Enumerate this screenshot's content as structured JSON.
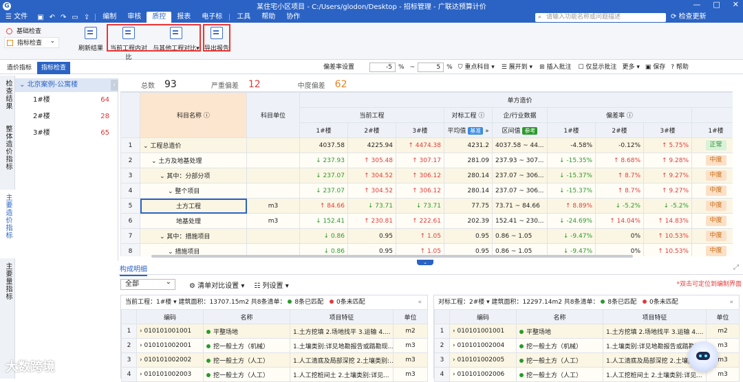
{
  "window": {
    "title": "某住宅小区项目 - C:/Users/glodon/Desktop - 招标管理 - 广联达预算计价",
    "controls": [
      "—",
      "□",
      "✕"
    ]
  },
  "menu": {
    "file": "文件",
    "items": [
      "编制",
      "审核",
      "质控",
      "报表",
      "电子标",
      "工具",
      "帮助",
      "协作"
    ],
    "active": "质控",
    "search_placeholder": "请输入功能名称或问题描述",
    "check_update": "检查更新"
  },
  "ribbon": {
    "leftnav": [
      "基础检查",
      "指标检查"
    ],
    "buttons": [
      "刷新结果",
      "当前工程内对比",
      "与其他工程对比",
      "导出报告"
    ]
  },
  "tabs": [
    "造价指标",
    "指标检查"
  ],
  "toolbar": {
    "deviation_label": "偏差率设置",
    "dev_low": "-5",
    "dev_high": "5",
    "pct": "%",
    "tilde": "~",
    "items": [
      "重点科目",
      "展开到",
      "插入批注",
      "仅显示批注",
      "更多",
      "保存",
      "帮助"
    ]
  },
  "side_tabs": [
    "检查结果",
    "整体造价指标",
    "主要造价指标",
    "主要量指标"
  ],
  "tree": {
    "root": "北京案例-公寓楼",
    "nodes": [
      {
        "label": "1#楼",
        "count": "64"
      },
      {
        "label": "2#楼",
        "count": "28"
      },
      {
        "label": "3#楼",
        "count": "65"
      }
    ]
  },
  "summary": {
    "total_label": "总数",
    "total": "93",
    "severe_label": "严重偏差",
    "severe": "12",
    "moderate_label": "中度偏差",
    "moderate": "62"
  },
  "grid": {
    "h_name": "科目名称",
    "h_unit": "科目单位",
    "h_unit_price": "单方造价",
    "h_current": "当前工程",
    "h_target": "对标工程",
    "h_industry": "企/行业数据",
    "h_deviation": "偏差率",
    "h_b1": "1#楼",
    "h_b2": "2#楼",
    "h_b3": "3#楼",
    "h_avg": "平均值",
    "h_avg_tag": "基准",
    "h_range": "区间值",
    "h_range_tag": "参考",
    "rows": [
      {
        "n": "1",
        "name": "工程总造价",
        "unit": "",
        "c1": "4037.58",
        "c2": "4225.94",
        "c3": "4474.38",
        "t": "4231.2",
        "r": "4037.58 ~ 44...",
        "d1": "-4.58%",
        "d2": "-0.12%",
        "d3": "5.75%",
        "s": "正常",
        "a": [
          "",
          "",
          "up"
        ],
        "da": [
          "",
          "",
          "up"
        ],
        "indent": 0
      },
      {
        "n": "2",
        "name": "土方及地基处理",
        "unit": "",
        "c1": "237.93",
        "c2": "305.48",
        "c3": "307.17",
        "t": "281.09",
        "r": "237.93 ~ 307...",
        "d1": "-15.35%",
        "d2": "8.68%",
        "d3": "9.28%",
        "s": "中度",
        "a": [
          "down",
          "up",
          "up"
        ],
        "da": [
          "down",
          "up",
          "up"
        ],
        "indent": 1
      },
      {
        "n": "3",
        "name": "其中：分部分项",
        "unit": "",
        "c1": "237.07",
        "c2": "304.52",
        "c3": "306.12",
        "t": "280.14",
        "r": "237.07 ~ 306...",
        "d1": "-15.37%",
        "d2": "8.7%",
        "d3": "9.27%",
        "s": "中度",
        "a": [
          "down",
          "up",
          "up"
        ],
        "da": [
          "down",
          "up",
          "up"
        ],
        "indent": 2
      },
      {
        "n": "4",
        "name": "整个项目",
        "unit": "",
        "c1": "237.07",
        "c2": "304.52",
        "c3": "306.12",
        "t": "280.14",
        "r": "237.07 ~ 306...",
        "d1": "-15.37%",
        "d2": "8.7%",
        "d3": "9.27%",
        "s": "中度",
        "a": [
          "down",
          "up",
          "up"
        ],
        "da": [
          "down",
          "up",
          "up"
        ],
        "indent": 3
      },
      {
        "n": "5",
        "name": "土方工程",
        "unit": "m3",
        "c1": "84.66",
        "c2": "73.71",
        "c3": "73.71",
        "t": "77.75",
        "r": "73.71 ~ 84.66",
        "d1": "8.89%",
        "d2": "-5.2%",
        "d3": "-5.2%",
        "s": "中度",
        "a": [
          "up",
          "down",
          "down"
        ],
        "da": [
          "up",
          "down",
          "down"
        ],
        "indent": 4
      },
      {
        "n": "6",
        "name": "地基处理",
        "unit": "m3",
        "c1": "152.41",
        "c2": "230.81",
        "c3": "222.61",
        "t": "202.39",
        "r": "152.41 ~ 230...",
        "d1": "-24.69%",
        "d2": "14.04%",
        "d3": "14.83%",
        "s": "中度",
        "a": [
          "down",
          "up",
          "up"
        ],
        "da": [
          "down",
          "up",
          "up"
        ],
        "indent": 4
      },
      {
        "n": "7",
        "name": "其中：措施项目",
        "unit": "",
        "c1": "0.86",
        "c2": "0.95",
        "c3": "1.05",
        "t": "0.95",
        "r": "0.86 ~ 1.05",
        "d1": "-9.47%",
        "d2": "0%",
        "d3": "10.53%",
        "s": "中度",
        "a": [
          "down",
          "",
          "up"
        ],
        "da": [
          "down",
          "",
          "up"
        ],
        "indent": 2
      },
      {
        "n": "8",
        "name": "措施项目",
        "unit": "",
        "c1": "0.86",
        "c2": "0.95",
        "c3": "1.05",
        "t": "0.95",
        "r": "0.86 ~ 1.05",
        "d1": "-9.47%",
        "d2": "0%",
        "d3": "10.53%",
        "s": "中度",
        "a": [
          "down",
          "",
          "up"
        ],
        "da": [
          "down",
          "",
          "up"
        ],
        "indent": 3
      }
    ]
  },
  "bottom": {
    "tab": "构成明细",
    "filter": "全部",
    "compare_setting": "清单对比设置",
    "col_setting": "列设置",
    "hint": "*双击可定位到编制界面",
    "left_pane": {
      "header": "当前工程：1#楼 ▾   建筑面积：13707.15m2   共8条清单：",
      "matched": "8条已匹配",
      "unmatched": "0条未匹配",
      "cols": [
        "编码",
        "名称",
        "项目特征",
        "单位"
      ],
      "rows": [
        {
          "n": "1",
          "code": "010101001001",
          "name": "平整场地",
          "feat": "1.土方挖填 2.场地找平 3.运输 4....",
          "unit": "m2"
        },
        {
          "n": "2",
          "code": "010101002001",
          "name": "挖一般土方（机械）",
          "feat": "1.土壤类别:详见地勘报告或踏勘现...",
          "unit": "m3"
        },
        {
          "n": "3",
          "code": "010101002002",
          "name": "挖一般土方（人工）",
          "feat": "1.人工清底及局部深挖 2.土壤类别:...",
          "unit": "m3"
        },
        {
          "n": "4",
          "code": "010101002003",
          "name": "挖一般土方（人工）",
          "feat": "1.人工挖桩间土 2.土壤类别:详见...",
          "unit": "m3"
        }
      ]
    },
    "right_pane": {
      "header": "对标工程：2#楼 ▾   建筑面积：12297.14m2   共8条清单：",
      "matched": "8条已匹配",
      "unmatched": "0条未匹配",
      "cols": [
        "编码",
        "名称",
        "项目特征",
        "单位"
      ],
      "rows": [
        {
          "n": "1",
          "code": "010101001001",
          "name": "平整场地",
          "feat": "1.土方挖填 2.场地找平 3.运输 4....",
          "unit": "m2"
        },
        {
          "n": "2",
          "code": "010101002004",
          "name": "挖一般土方（机械）",
          "feat": "1.土壤类别:详见地勘报告或踏勘现...",
          "unit": "m3"
        },
        {
          "n": "3",
          "code": "010101002005",
          "name": "挖一般土方（人工）",
          "feat": "1.人工清底及局部深挖 2.土壤类别:...",
          "unit": "m3"
        },
        {
          "n": "4",
          "code": "010101002006",
          "name": "挖一般土方（人工）",
          "feat": "1.人工挖桩间土 2.土壤类别:详见...",
          "unit": "m3"
        }
      ]
    }
  },
  "watermark": "大数跨境"
}
